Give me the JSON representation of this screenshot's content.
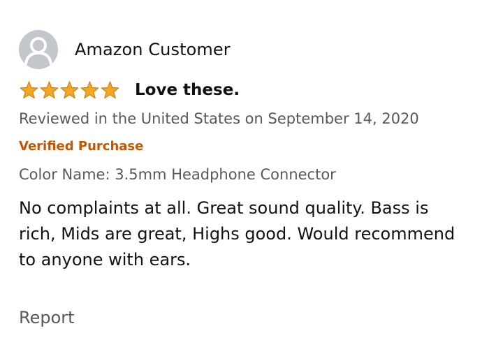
{
  "review": {
    "author": "Amazon Customer",
    "avatar_icon": "default-person-icon",
    "rating": 5,
    "rating_max": 5,
    "star_color": "#f5a623",
    "title": "Love these.",
    "date_line": "Reviewed in the United States on September 14, 2020",
    "verified_label": "Verified Purchase",
    "verified_color": "#c45500",
    "variant_line": "Color Name: 3.5mm Headphone Connector",
    "body": "No complaints at all. Great sound quality. Bass is rich, Mids are great, Highs good. Would recommend to anyone with ears.",
    "report_label": "Report"
  }
}
